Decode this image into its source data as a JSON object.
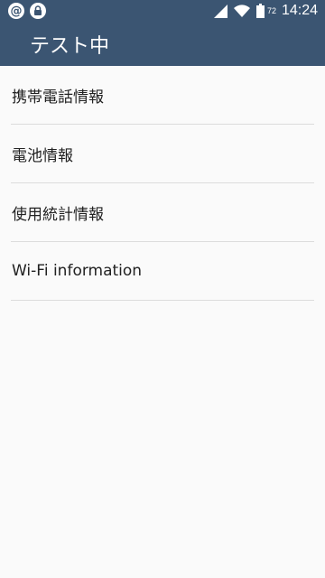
{
  "status_bar": {
    "left_icons": [
      {
        "name": "at-sign-icon",
        "glyph": "@"
      },
      {
        "name": "lock-icon",
        "glyph": "🔒"
      }
    ],
    "battery_percent": "72",
    "time": "14:24"
  },
  "app_bar": {
    "title": "テスト中"
  },
  "list": {
    "items": [
      {
        "label": "携帯電話情報"
      },
      {
        "label": "電池情報"
      },
      {
        "label": "使用統計情報"
      },
      {
        "label": "Wi-Fi information"
      }
    ]
  },
  "colors": {
    "bar": "#3b5572",
    "background": "#fafafa",
    "divider": "#dcdcdc"
  }
}
